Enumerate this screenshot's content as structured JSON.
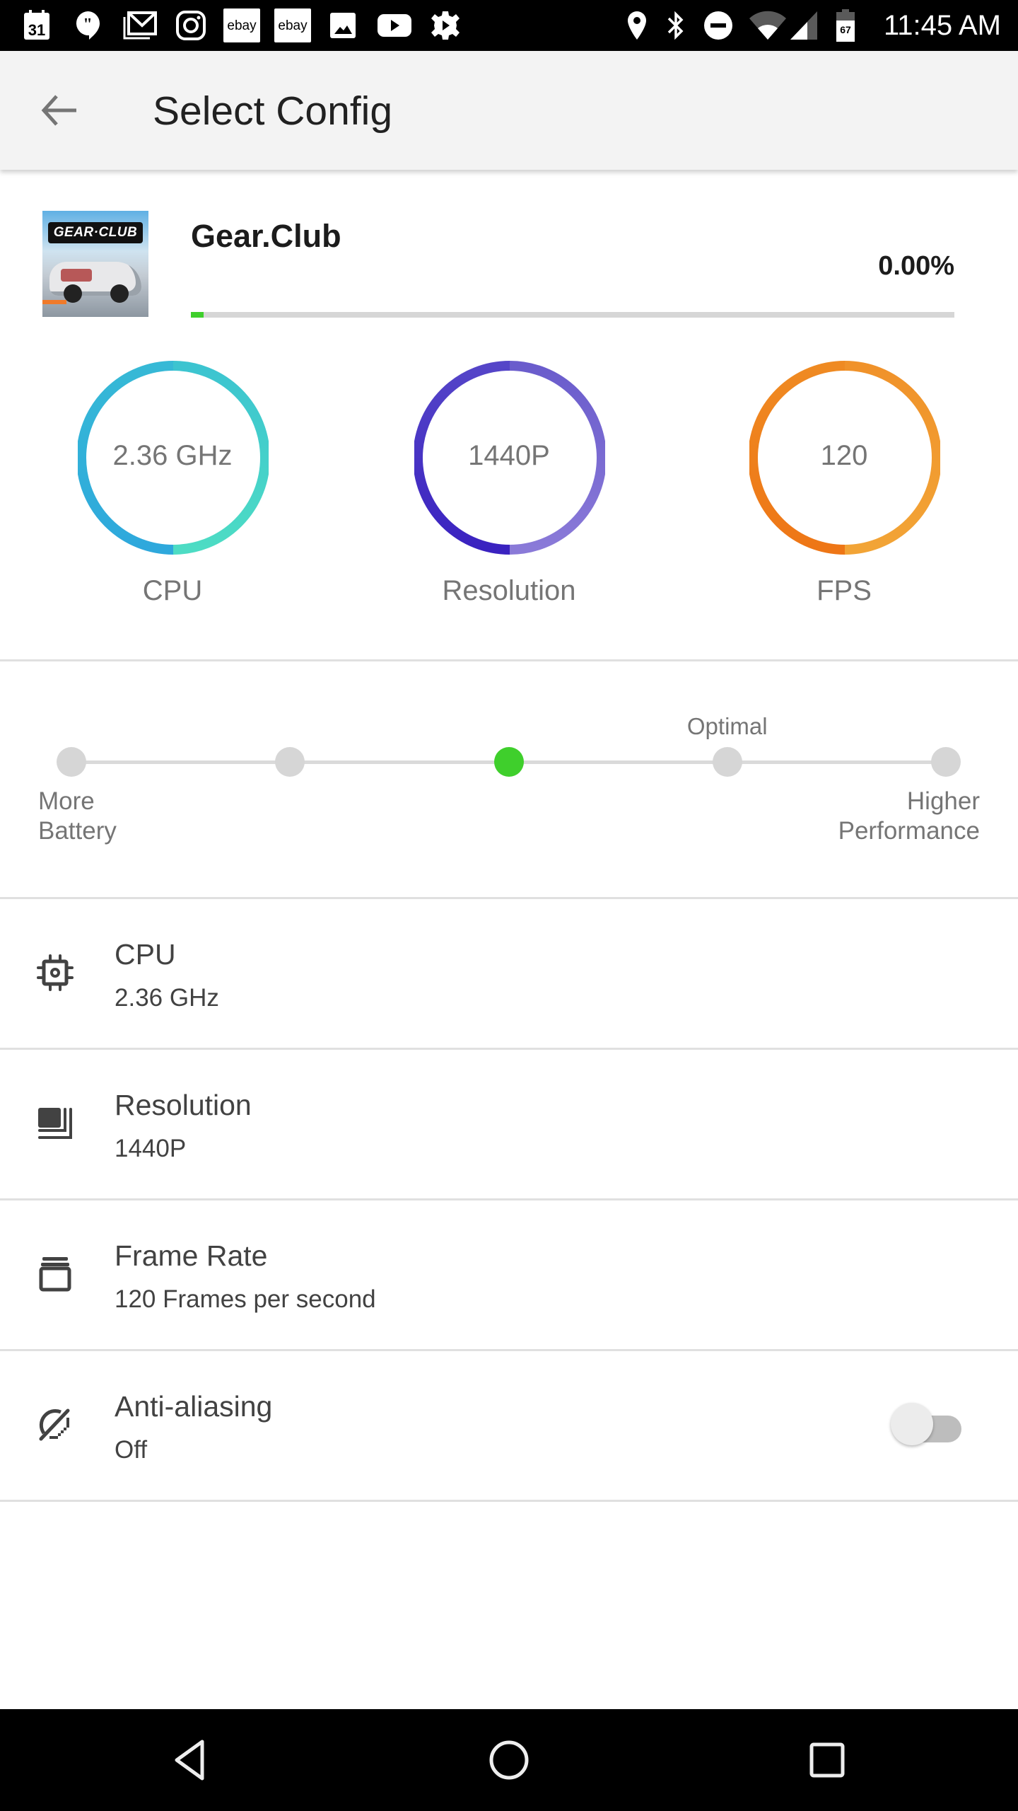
{
  "status_bar": {
    "time": "11:45 AM",
    "battery_level": "67",
    "left_icons": [
      "calendar-icon",
      "hangouts-icon",
      "gmail-icon",
      "instagram-icon",
      "ebay-icon",
      "ebay-icon",
      "photos-icon",
      "youtube-icon",
      "settings-icon"
    ],
    "right_icons": [
      "location-icon",
      "bluetooth-icon",
      "do-not-disturb-icon",
      "wifi-icon",
      "cell-signal-icon",
      "battery-icon"
    ],
    "calendar_day": "31",
    "ebay_label": "ebay"
  },
  "app_bar": {
    "title": "Select Config",
    "back_icon": "arrow-back-icon"
  },
  "game": {
    "name": "Gear.Club",
    "thumbnail_logo": "GEAR·CLUB",
    "percent_text": "0.00%",
    "progress_percent": 0,
    "progress_color": "#3fcf2c"
  },
  "gauges": [
    {
      "value": "2.36 GHz",
      "label": "CPU",
      "color_start": "#2ea8dc",
      "color_end": "#4ddcc4"
    },
    {
      "value": "1440P",
      "label": "Resolution",
      "color_start": "#3a22c0",
      "color_end": "#8a7ad8"
    },
    {
      "value": "120",
      "label": "FPS",
      "color_start": "#ee7616",
      "color_end": "#f2a436"
    }
  ],
  "performance_slider": {
    "steps": 5,
    "selected_index": 2,
    "optimal_index": 3,
    "optimal_label": "Optimal",
    "left_label_line1": "More",
    "left_label_line2": "Battery",
    "right_label_line1": "Higher",
    "right_label_line2": "Performance",
    "active_color": "#3fcf2c"
  },
  "settings": [
    {
      "icon": "cpu-chip-icon",
      "title": "CPU",
      "value": "2.36 GHz"
    },
    {
      "icon": "resolution-icon",
      "title": "Resolution",
      "value": "1440P"
    },
    {
      "icon": "frame-rate-icon",
      "title": "Frame Rate",
      "value": "120 Frames per second"
    },
    {
      "icon": "anti-aliasing-icon",
      "title": "Anti-aliasing",
      "value": "Off",
      "toggle_on": false
    }
  ],
  "nav_bar": {
    "buttons": [
      "nav-back-icon",
      "nav-home-icon",
      "nav-recents-icon"
    ]
  }
}
